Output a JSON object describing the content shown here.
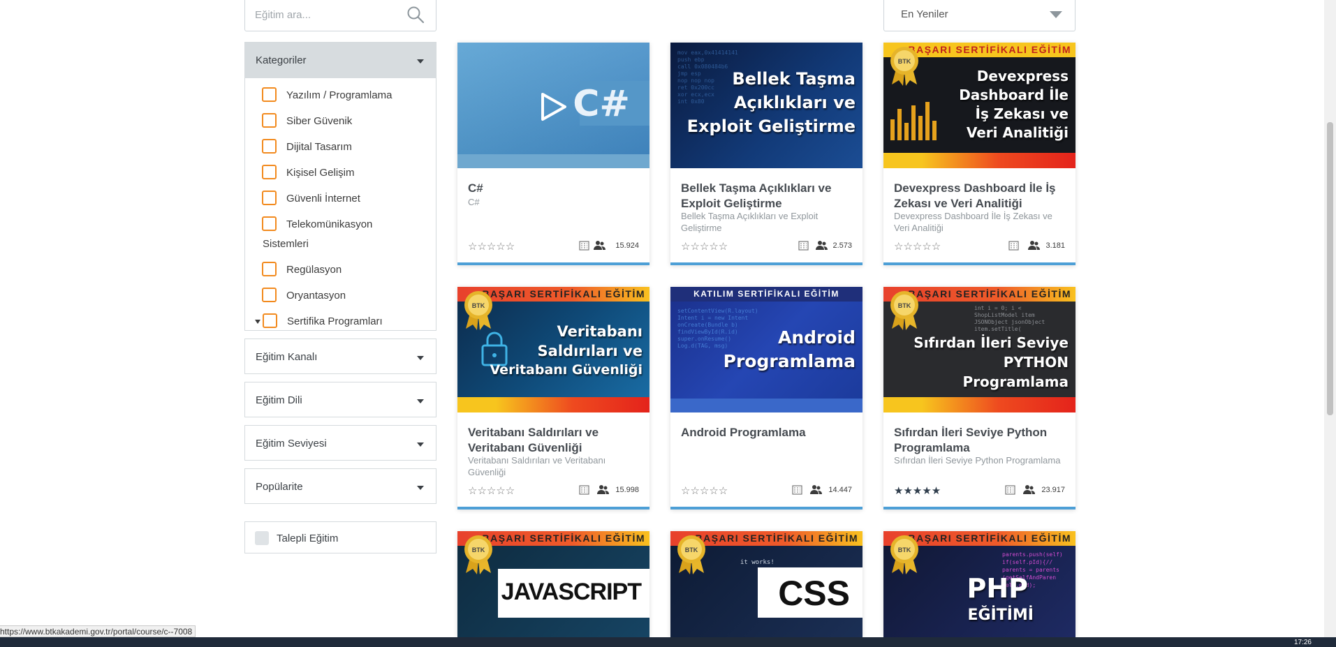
{
  "search": {
    "placeholder": "Eğitim ara..."
  },
  "sort": {
    "selected": "En Yeniler"
  },
  "sidebar": {
    "categories_title": "Kategoriler",
    "categories": [
      "Yazılım / Programlama",
      "Siber Güvenik",
      "Dijital Tasarım",
      "Kişisel Gelişim",
      "Güvenli İnternet",
      "Telekomünikasyon",
      "Sistemleri",
      "Regülasyon",
      "Oryantasyon",
      "Sertifika Programları"
    ],
    "filters": [
      "Eğitim Kanalı",
      "Eğitim Dili",
      "Eğitim Seviyesi",
      "Popülarite"
    ],
    "talepli": "Talepli Eğitim"
  },
  "courses": [
    {
      "title": "C#",
      "subtitle": "C#",
      "count": "15.924",
      "banner": "",
      "cover_text": "C#",
      "rating": 0
    },
    {
      "title": "Bellek Taşma Açıklıkları ve Exploit Geliştirme",
      "subtitle": "Bellek Taşma Açıklıkları ve Exploit Geliştirme",
      "count": "2.573",
      "cover_l1": "Bellek Taşma",
      "cover_l2": "Açıklıkları ve",
      "cover_l3": "Exploit Geliştirme",
      "rating": 0
    },
    {
      "title": "Devexpress Dashboard İle İş Zekası ve Veri Analitiği",
      "subtitle": "Devexpress Dashboard İle İş Zekası ve Veri Analitiği",
      "count": "3.181",
      "banner": "BAŞARI SERTİFİKALI EĞİTİM",
      "cover_l1": "Devexpress",
      "cover_l2": "Dashboard İle",
      "cover_l3": "İş Zekası ve",
      "cover_l4": "Veri Analitiği",
      "rating": 0
    },
    {
      "title": "Veritabanı Saldırıları ve Veritabanı Güvenliği",
      "subtitle": "Veritabanı Saldırıları ve Veritabanı Güvenliği",
      "count": "15.998",
      "banner": "BAŞARI SERTİFİKALI EĞİTİM",
      "cover_l1": "Veritabanı",
      "cover_l2": "Saldırıları ve",
      "cover_l3": "Veritabanı Güvenliği",
      "rating": 0
    },
    {
      "title": "Android Programlama",
      "subtitle": "",
      "count": "14.447",
      "banner": "KATILIM SERTİFİKALI EĞİTİM",
      "cover_l1": "Android",
      "cover_l2": "Programlama",
      "rating": 0
    },
    {
      "title": "Sıfırdan İleri Seviye Python Programlama",
      "subtitle": "Sıfırdan İleri Seviye Python Programlama",
      "count": "23.917",
      "banner": "BAŞARI SERTİFİKALI EĞİTİM",
      "cover_l1": "Sıfırdan İleri Seviye",
      "cover_l2": "PYTHON",
      "cover_l3": "Programlama",
      "rating": 5
    },
    {
      "banner": "BAŞARI SERTİFİKALI EĞİTİM",
      "cover_text": "JAVASCRIPT"
    },
    {
      "banner": "BAŞARI SERTİFİKALI EĞİTİM",
      "cover_text": "CSS",
      "cover_code": "it works!"
    },
    {
      "banner": "BAŞARI SERTİFİKALI EĞİTİM",
      "cover_l1": "PHP",
      "cover_l2": "EĞİTİMİ"
    }
  ],
  "status_url": "https://www.btkakademi.gov.tr/portal/course/c--7008",
  "clock": "17:26",
  "colors": {
    "accent_orange": "#f28a1e",
    "card_bar_blue": "#4d9fd6",
    "taskbar": "#1f2a3a"
  }
}
